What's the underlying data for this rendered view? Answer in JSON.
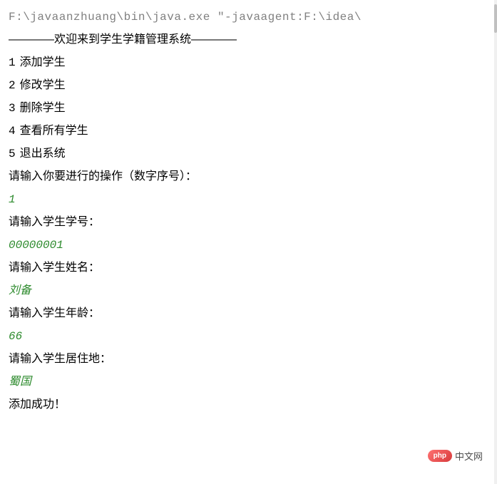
{
  "command": "F:\\javaanzhuang\\bin\\java.exe \"-javaagent:F:\\idea\\",
  "welcome": "————欢迎来到学生学籍管理系统————",
  "menu": [
    {
      "num": "1",
      "label": "添加学生"
    },
    {
      "num": "2",
      "label": "修改学生"
    },
    {
      "num": "3",
      "label": "删除学生"
    },
    {
      "num": "4",
      "label": "查看所有学生"
    },
    {
      "num": "5",
      "label": "退出系统"
    }
  ],
  "prompts": {
    "action": "请输入你要进行的操作（数字序号）：",
    "student_id": "请输入学生学号：",
    "student_name": "请输入学生姓名：",
    "student_age": "请输入学生年龄：",
    "student_addr": "请输入学生居住地："
  },
  "inputs": {
    "action": "1",
    "student_id": "00000001",
    "student_name": "刘备",
    "student_age": "66",
    "student_addr": "蜀国"
  },
  "result": "添加成功！",
  "watermark": {
    "badge": "php",
    "text": "中文网"
  }
}
